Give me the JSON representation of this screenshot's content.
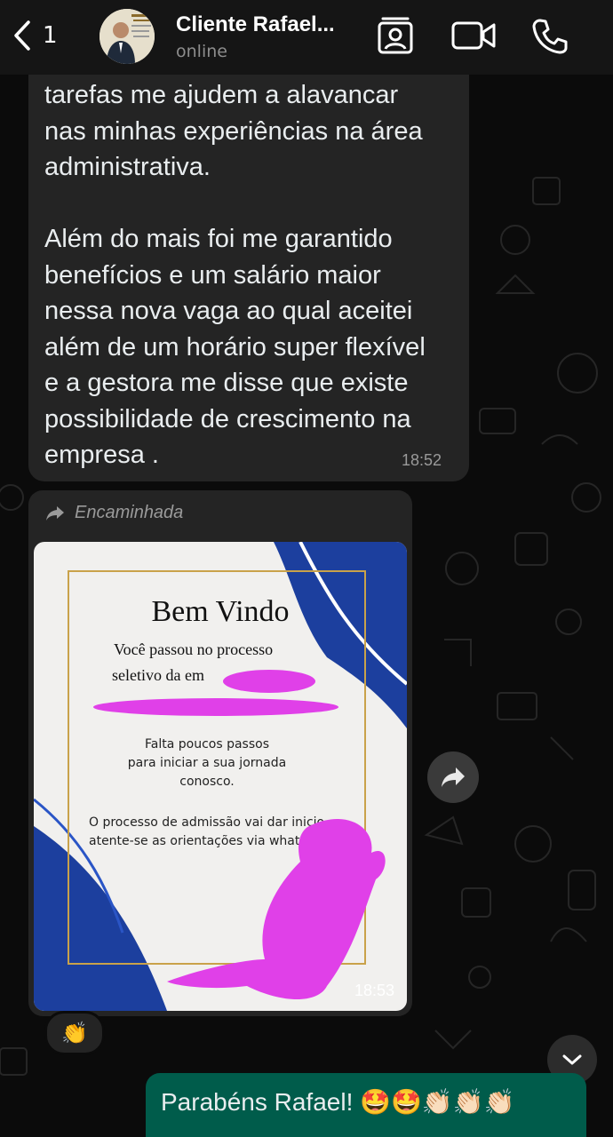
{
  "header": {
    "back_count": "1",
    "contact_name": "Cliente Rafael...",
    "status": "online"
  },
  "messages": [
    {
      "text": "tarefas me ajudem a alavancar\nnas minhas experiências na área\nadministrativa.\n\nAlém do mais foi me garantido\nbenefícios e um salário maior\nnessa nova vaga ao qual aceitei\nalém de um horário super flexível\ne a gestora me disse que existe\npossibilidade de crescimento na\nempresa .",
      "time": "18:52"
    },
    {
      "forwarded_label": "Encaminhada",
      "image": {
        "title": "Bem Vindo",
        "line1": "Você passou no processo",
        "line2": "seletivo da em",
        "subtitle": "Falta poucos passos\npara iniciar a sua jornada\nconosco.",
        "paragraph": "O processo de admissão vai dar inicio\natente-se as orientações via whats"
      },
      "time": "18:53",
      "reaction": "👏"
    },
    {
      "text": "Parabéns Rafael! 🤩🤩👏🏻👏🏻👏🏻"
    }
  ],
  "colors": {
    "incoming_bubble": "#242424",
    "outgoing_bubble": "#005c4b",
    "header_bg": "#151515",
    "redaction": "#e040e8"
  },
  "icons": [
    "back-chevron-icon",
    "contact-card-icon",
    "video-call-icon",
    "phone-icon",
    "forward-icon",
    "chevron-down-icon"
  ]
}
